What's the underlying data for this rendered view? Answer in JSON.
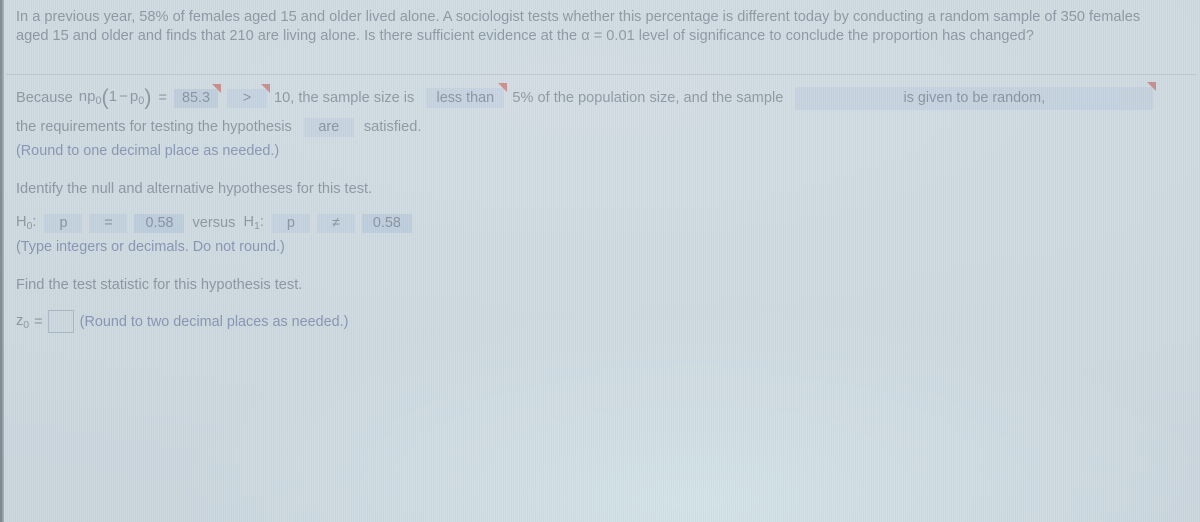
{
  "question": {
    "text": "In a previous year, 58% of females aged 15 and older lived alone. A sociologist tests whether this percentage is different today by conducting a random sample of 350 females aged 15 and older and finds that 210 are living alone. Is there sufficient evidence at the α = 0.01 level of significance to conclude the proportion has changed?"
  },
  "requirements": {
    "because_label": "Because",
    "formula_lead": "np",
    "formula_sub0": "0",
    "formula_paren_open": "(",
    "formula_one": "1",
    "formula_minus": "−",
    "formula_p": "p",
    "formula_paren_close": ")",
    "equals": "=",
    "np_value": "85.3",
    "comparison_operator": ">",
    "threshold_text": "10, the sample size is",
    "sample_size_relation": "less than",
    "percent_text": "5% of the population size, and the sample",
    "randomness_statement": "is given to be random,",
    "requirements_lead": "the requirements for testing the hypothesis",
    "are_value": "are",
    "satisfied_text": "satisfied.",
    "round_note": "(Round to one decimal place as needed.)"
  },
  "hypotheses": {
    "prompt": "Identify the null and alternative hypotheses for this test.",
    "h0_label": "H",
    "h0_sub": "0",
    "h0_colon": ":",
    "h0_param": "p",
    "h0_operator": "=",
    "h0_value": "0.58",
    "versus": "versus",
    "h1_label": "H",
    "h1_sub": "1",
    "h1_colon": ":",
    "h1_param": "p",
    "h1_operator": "≠",
    "h1_value": "0.58",
    "round_note": "(Type integers or decimals. Do not round.)"
  },
  "test_statistic": {
    "prompt": "Find the test statistic for this hypothesis test.",
    "z_label": "z",
    "z_sub": "0",
    "equals": "=",
    "value": "",
    "round_note": "(Round to two decimal places as needed.)"
  },
  "colors": {
    "page_background": "#cfdae1",
    "body_text": "#3d4b5b",
    "note_text": "#36477e",
    "field_background": "#b8c9dd",
    "field_filled_background": "#aabfd6",
    "field_text": "#33415a",
    "flag_marker": "#c0352b",
    "divider": "#9bacba"
  }
}
